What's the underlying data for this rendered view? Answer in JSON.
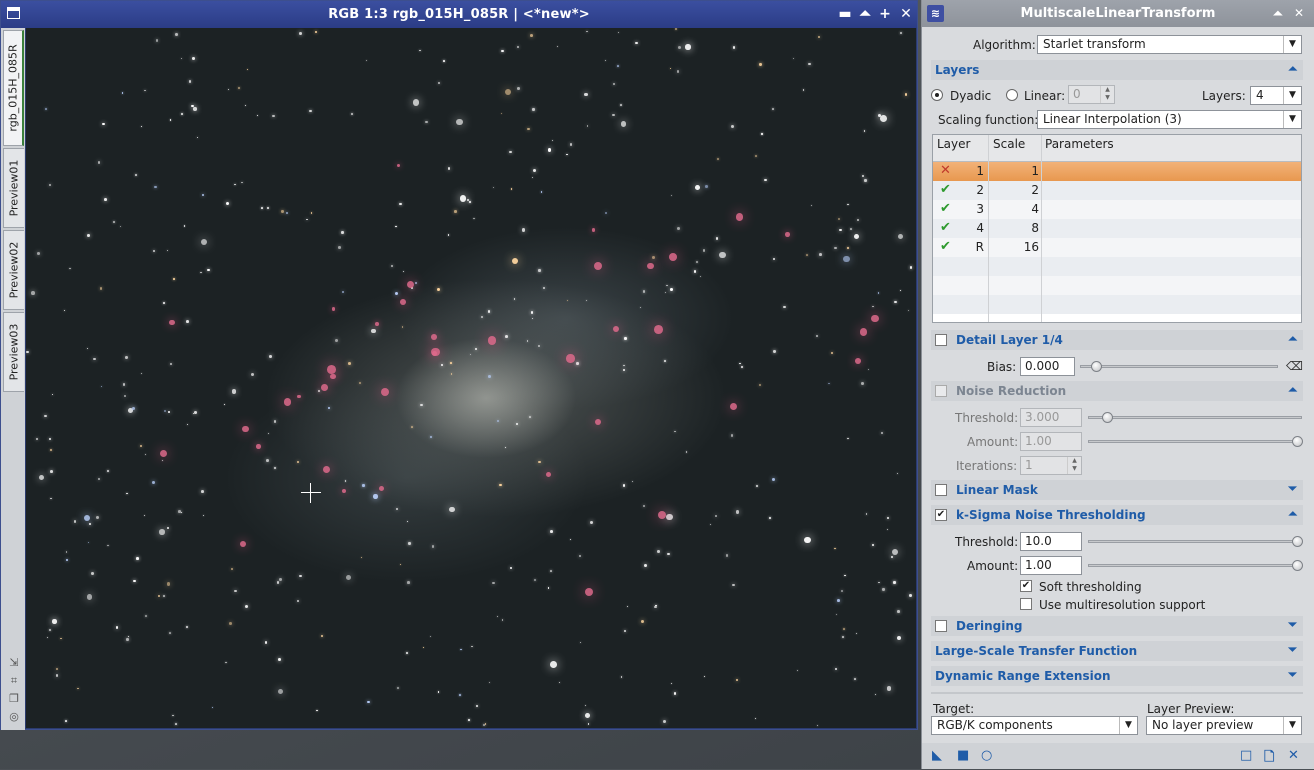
{
  "image_window": {
    "title": "RGB 1:3 rgb_015H_085R | <*new*>",
    "controls": [
      "▬",
      "⏶",
      "+",
      "✕"
    ],
    "tabs": [
      "rgb_015H_085R",
      "Preview01",
      "Preview02",
      "Preview03"
    ]
  },
  "process": {
    "title": "MultiscaleLinearTransform",
    "algorithm_label": "Algorithm:",
    "algorithm_value": "Starlet transform",
    "layers_section": "Layers",
    "dyadic_label": "Dyadic",
    "linear_label": "Linear:",
    "linear_value": "0",
    "layers_label": "Layers:",
    "layers_value": "4",
    "scaling_label": "Scaling function:",
    "scaling_value": "Linear Interpolation (3)",
    "table": {
      "headers": [
        "Layer",
        "Scale",
        "Parameters"
      ],
      "rows": [
        {
          "mark": "✕",
          "layer": "1",
          "scale": "1"
        },
        {
          "mark": "✔",
          "layer": "2",
          "scale": "2"
        },
        {
          "mark": "✔",
          "layer": "3",
          "scale": "4"
        },
        {
          "mark": "✔",
          "layer": "4",
          "scale": "8"
        },
        {
          "mark": "✔",
          "layer": "R",
          "scale": "16"
        }
      ]
    },
    "detail_section": "Detail Layer 1/4",
    "bias_label": "Bias:",
    "bias_value": "0.000",
    "noise_section": "Noise Reduction",
    "nr_threshold_label": "Threshold:",
    "nr_threshold_value": "3.000",
    "nr_amount_label": "Amount:",
    "nr_amount_value": "1.00",
    "nr_iterations_label": "Iterations:",
    "nr_iterations_value": "1",
    "linear_mask_section": "Linear Mask",
    "ksigma_section": "k-Sigma Noise Thresholding",
    "ks_threshold_label": "Threshold:",
    "ks_threshold_value": "10.0",
    "ks_amount_label": "Amount:",
    "ks_amount_value": "1.00",
    "soft_label": "Soft thresholding",
    "multires_label": "Use multiresolution support",
    "deringing_section": "Deringing",
    "lstf_section": "Large-Scale Transfer Function",
    "dre_section": "Dynamic Range Extension",
    "target_label": "Target:",
    "target_value": "RGB/K components",
    "preview_label": "Layer Preview:",
    "preview_value": "No layer preview"
  },
  "colors": {
    "accent": "#1f5ca8",
    "selection": "#e8984f",
    "check_green": "#2e9a2e",
    "x_red": "#c0392b"
  }
}
